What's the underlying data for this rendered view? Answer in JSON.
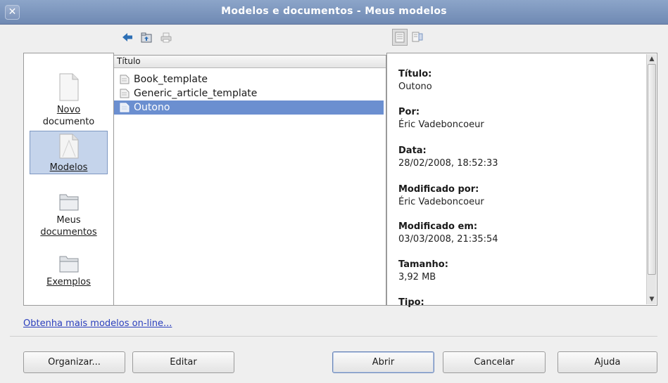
{
  "window": {
    "title": "Modelos e documentos - Meus modelos",
    "close_glyph": "✕"
  },
  "toolbar": {
    "icons": [
      "back-arrow-icon",
      "up-folder-icon",
      "print-icon",
      "document-preview-icon",
      "document-properties-icon"
    ]
  },
  "sidebar": {
    "items": [
      {
        "line1": "Novo",
        "line2": "documento",
        "icon": "new-document-icon"
      },
      {
        "label": "Modelos",
        "icon": "templates-icon",
        "selected": true
      },
      {
        "line1": "Meus",
        "line2": "documentos",
        "icon": "folder-icon"
      },
      {
        "label": "Exemplos",
        "icon": "folder-icon"
      }
    ]
  },
  "list": {
    "header": "Título",
    "rows": [
      {
        "name": "Book_template",
        "icon": "template-file-icon"
      },
      {
        "name": "Generic_article_template",
        "icon": "template-file-icon"
      },
      {
        "name": "Outono",
        "icon": "template-file-icon",
        "selected": true
      }
    ]
  },
  "details": {
    "title_label": "Título:",
    "title_value": "Outono",
    "by_label": "Por:",
    "by_value": "Éric Vadeboncoeur",
    "date_label": "Data:",
    "date_value": "28/02/2008, 18:52:33",
    "modified_by_label": "Modificado por:",
    "modified_by_value": "Éric Vadeboncoeur",
    "modified_on_label": "Modificado em:",
    "modified_on_value": "03/03/2008, 21:35:54",
    "size_label": "Tamanho:",
    "size_value": "3,92 MB",
    "type_label": "Tipo:"
  },
  "link": {
    "text": "Obtenha mais modelos on-line..."
  },
  "buttons": {
    "organize": "Organizar...",
    "edit": "Editar",
    "open": "Abrir",
    "cancel": "Cancelar",
    "help": "Ajuda"
  },
  "colors": {
    "selection": "#6b8fd0",
    "titlebar": "#7f98c0",
    "link": "#2a3ebd"
  }
}
